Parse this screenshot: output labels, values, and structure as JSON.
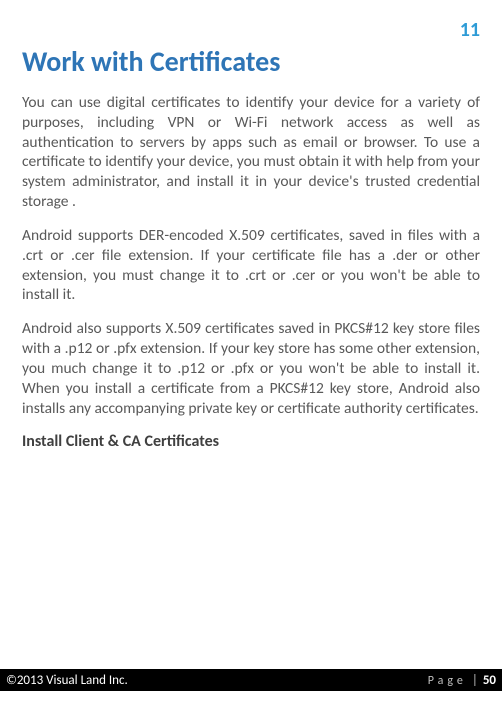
{
  "section_number": "11",
  "title": "Work with Certificates",
  "paragraphs": {
    "p1": "You can use digital certificates to identify your device for a variety of purposes, including VPN or Wi-Fi network access as well as authentication to servers by apps such as email or browser. To use a certificate to identify your device, you must obtain it with help from your system administrator, and install it in your device's trusted credential storage .",
    "p2": "Android supports DER-encoded X.509 certificates, saved in files with a .crt or .cer file extension. If your certificate file has a .der or other extension, you must change it to .crt or .cer or you won't be able to install it.",
    "p3": "Android also supports X.509 certificates saved in PKCS#12 key store files with a .p12 or .pfx extension. If your key store has some other extension, you much change it to .p12 or .pfx or you won't be able to install it. When you install a certificate from a PKCS#12 key store, Android also installs any accompanying private key or certificate authority certificates."
  },
  "subsection_title": "Install Client & CA Certificates",
  "footer": {
    "copyright": "©2013 Visual Land Inc.",
    "page_label": "Page",
    "page_sep": "|",
    "page_number": "50"
  }
}
